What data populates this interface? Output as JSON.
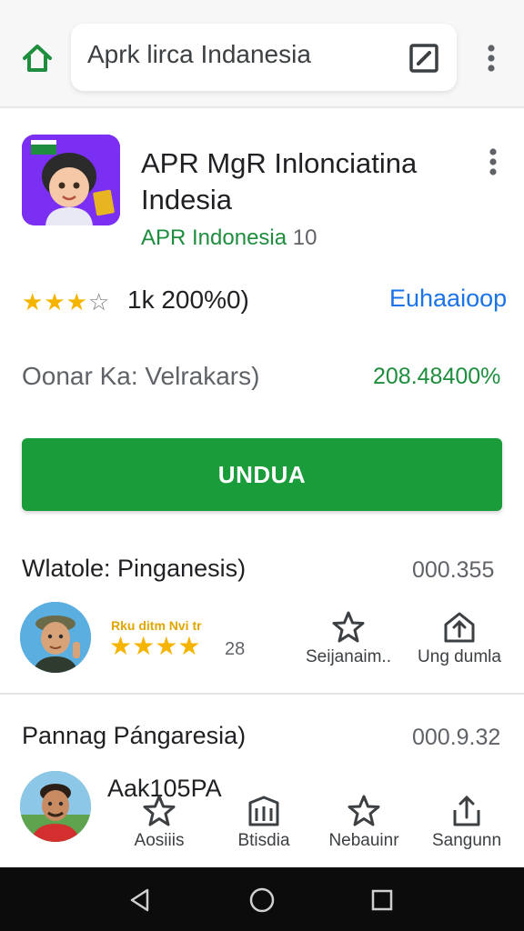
{
  "topbar": {
    "home_icon": "home-icon",
    "search_text": "Aprk lirca Indanesia",
    "edit_icon": "edit-box-icon",
    "menu_icon": "more-vert-icon"
  },
  "app": {
    "title": "APR MgR Inlonciatina Indesia",
    "developer": "APR Indonesia",
    "version": "10",
    "menu_icon": "more-vert-icon"
  },
  "rating": {
    "stars_value": 3,
    "stars_max": 5,
    "text": "1k 200%0)",
    "link": "Euhaaioop"
  },
  "info": {
    "label": "Oonar Ka: Velrakars)",
    "value": "208.48400%"
  },
  "install": {
    "label": "UNDUA"
  },
  "section1": {
    "title": "Wlatole: Pinganesis)",
    "number": "000.355",
    "reviewer_name": "Rku ditm Nvi tr",
    "reviewer_stars": 4,
    "review_count": "28",
    "actions": [
      {
        "label": "Seijanaim..",
        "icon": "star-outline-icon"
      },
      {
        "label": "Ung dumla",
        "icon": "upload-house-icon"
      }
    ]
  },
  "section2": {
    "title": "Pannag Pángaresia)",
    "number": "000.9.32",
    "reviewer_name": "Aak105PA"
  },
  "bottom_tabs": [
    {
      "label": "Aosiiis",
      "icon": "star-outline-icon"
    },
    {
      "label": "Btisdia",
      "icon": "library-icon"
    },
    {
      "label": "Nebauinr",
      "icon": "star-outline-icon"
    },
    {
      "label": "Sangunn",
      "icon": "share-icon"
    }
  ],
  "system_nav": {
    "back_icon": "back-triangle-icon",
    "home_icon": "home-circle-icon",
    "recents_icon": "recents-square-icon"
  },
  "colors": {
    "accent_green": "#1a9c3a",
    "link_blue": "#1a73e8",
    "star_gold": "#f5b400",
    "app_icon_purple": "#7b2ff2"
  }
}
